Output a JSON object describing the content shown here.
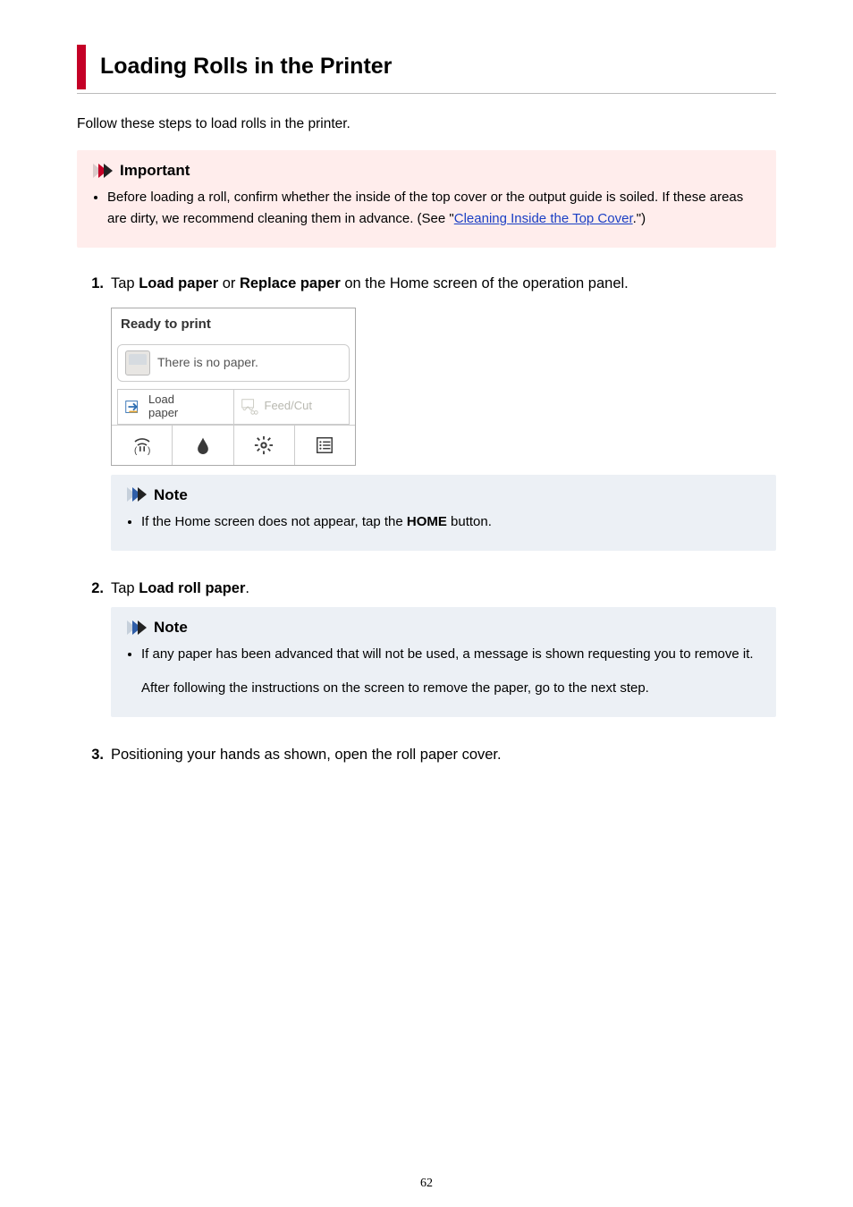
{
  "title": "Loading Rolls in the Printer",
  "intro": "Follow these steps to load rolls in the printer.",
  "important": {
    "label": "Important",
    "items": [
      {
        "pre": "Before loading a roll, confirm whether the inside of the top cover or the output guide is soiled. If these areas are dirty, we recommend cleaning them in advance. (See \"",
        "link": "Cleaning Inside the Top Cover",
        "post": ".\")"
      }
    ]
  },
  "steps": {
    "s1": {
      "num": "1.",
      "t1": "Tap ",
      "b1": "Load paper",
      "t2": " or ",
      "b2": "Replace paper",
      "t3": " on the Home screen of the operation panel."
    },
    "s2": {
      "num": "2.",
      "t1": "Tap ",
      "b1": "Load roll paper",
      "t2": "."
    },
    "s3": {
      "num": "3.",
      "text": "Positioning your hands as shown, open the roll paper cover."
    }
  },
  "note1": {
    "label": "Note",
    "item_pre": "If the Home screen does not appear, tap the ",
    "item_bold": "HOME",
    "item_post": " button."
  },
  "note2": {
    "label": "Note",
    "item1": "If any paper has been advanced that will not be used, a message is shown requesting you to remove it.",
    "item2": "After following the instructions on the screen to remove the paper, go to the next step."
  },
  "panel": {
    "status": "Ready to print",
    "msg": "There is no paper.",
    "load_l1": "Load",
    "load_l2": "paper",
    "feedcut": "Feed/Cut",
    "icons": {
      "wifi": "wifi-icon",
      "ink": "ink-drop-icon",
      "gear": "gear-icon",
      "jobs": "job-list-icon"
    }
  },
  "page_number": "62",
  "colors": {
    "accent": "#c40026",
    "important_bg": "#ffedec",
    "note_bg": "#ecf0f5",
    "link": "#1a3fc4"
  }
}
